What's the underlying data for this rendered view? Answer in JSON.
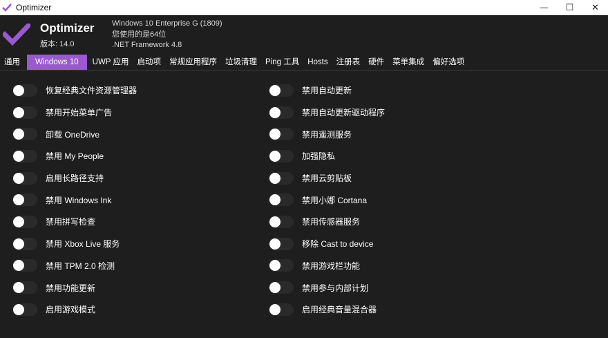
{
  "window": {
    "title": "Optimizer",
    "controls": {
      "minimize": "—",
      "maximize": "☐",
      "close": "✕"
    }
  },
  "header": {
    "app_name": "Optimizer",
    "version": "版本: 14.0",
    "os": "Windows 10 Enterprise G (1809)",
    "arch": "您使用的是64位",
    "framework": ".NET Framework 4.8"
  },
  "colors": {
    "accent": "#9b59d0",
    "background": "#1e1e1e",
    "toggle_track": "#2a2a2a",
    "toggle_knob": "#ffffff"
  },
  "tabs": [
    {
      "label": "通用"
    },
    {
      "label": "Windows 10",
      "active": true
    },
    {
      "label": "UWP 应用"
    },
    {
      "label": "启动项"
    },
    {
      "label": "常规应用程序"
    },
    {
      "label": "垃圾清理"
    },
    {
      "label": "Ping 工具"
    },
    {
      "label": "Hosts"
    },
    {
      "label": "注册表"
    },
    {
      "label": "硬件"
    },
    {
      "label": "菜单集成"
    },
    {
      "label": "偏好选项"
    }
  ],
  "left_options": [
    {
      "label": "恢复经典文件资源管理器",
      "on": false
    },
    {
      "label": "禁用开始菜单广告",
      "on": false
    },
    {
      "label": "卸载 OneDrive",
      "on": false
    },
    {
      "label": "禁用 My People",
      "on": false
    },
    {
      "label": "启用长路径支持",
      "on": false
    },
    {
      "label": "禁用 Windows Ink",
      "on": false
    },
    {
      "label": "禁用拼写检查",
      "on": false
    },
    {
      "label": "禁用 Xbox Live 服务",
      "on": false
    },
    {
      "label": "禁用 TPM 2.0 检测",
      "on": false
    },
    {
      "label": "禁用功能更新",
      "on": false
    },
    {
      "label": "启用游戏模式",
      "on": false
    }
  ],
  "right_options": [
    {
      "label": "禁用自动更新",
      "on": false
    },
    {
      "label": "禁用自动更新驱动程序",
      "on": false
    },
    {
      "label": "禁用遥测服务",
      "on": false
    },
    {
      "label": "加强隐私",
      "on": false
    },
    {
      "label": "禁用云剪贴板",
      "on": false
    },
    {
      "label": "禁用小娜 Cortana",
      "on": false
    },
    {
      "label": "禁用传感器服务",
      "on": false
    },
    {
      "label": "移除 Cast to device",
      "on": false
    },
    {
      "label": "禁用游戏栏功能",
      "on": false
    },
    {
      "label": "禁用参与内部计划",
      "on": false
    },
    {
      "label": "启用经典音量混合器",
      "on": false
    }
  ]
}
